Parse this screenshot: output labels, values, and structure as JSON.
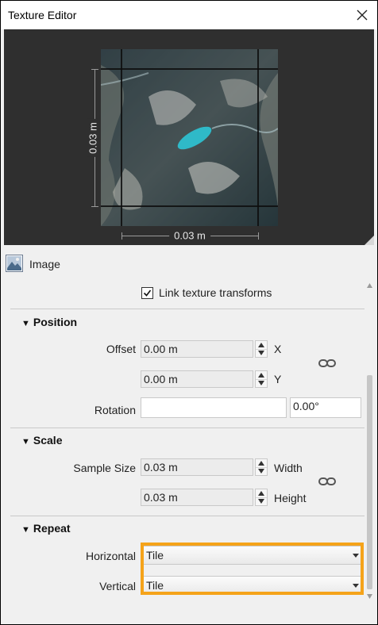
{
  "window": {
    "title": "Texture Editor"
  },
  "preview": {
    "dimension_vertical": "0.03 m",
    "dimension_horizontal": "0.03 m"
  },
  "image_row": {
    "label": "Image"
  },
  "link_texture": {
    "label": "Link texture transforms",
    "checked": true
  },
  "position": {
    "heading": "Position",
    "offset_label": "Offset",
    "offset_x": "0.00 m",
    "offset_y": "0.00 m",
    "x_label": "X",
    "y_label": "Y",
    "rotation_label": "Rotation",
    "rotation_value": "",
    "rotation_degrees": "0.00°"
  },
  "scale": {
    "heading": "Scale",
    "sample_size_label": "Sample Size",
    "width_value": "0.03 m",
    "height_value": "0.03 m",
    "width_label": "Width",
    "height_label": "Height"
  },
  "repeat": {
    "heading": "Repeat",
    "horizontal_label": "Horizontal",
    "horizontal_value": "Tile",
    "vertical_label": "Vertical",
    "vertical_value": "Tile"
  },
  "colors": {
    "highlight": "#f5a31a",
    "preview_bg": "#2f2f2f",
    "panel_bg": "#f0f0f0"
  }
}
